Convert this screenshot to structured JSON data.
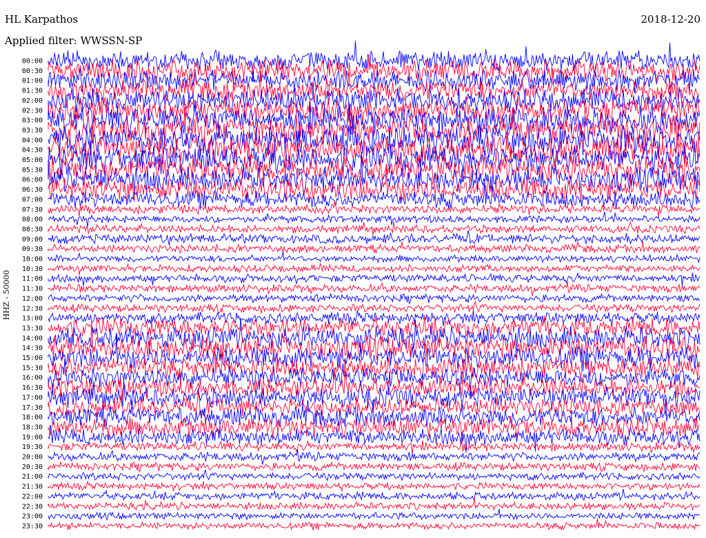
{
  "header": {
    "station": "HL Karpathos",
    "date": "2018-12-20",
    "filter": "Applied filter: WWSSN-SP"
  },
  "chart_data": {
    "type": "line",
    "title": "HL Karpathos",
    "ylabel": "HHZ - 50000",
    "colors": [
      "#0000ff",
      "#ff0033"
    ],
    "rows": [
      "00:00",
      "00:30",
      "01:00",
      "01:30",
      "02:00",
      "02:30",
      "03:00",
      "03:30",
      "04:00",
      "04:30",
      "05:00",
      "05:30",
      "06:00",
      "06:30",
      "07:00",
      "07:30",
      "08:00",
      "08:30",
      "09:00",
      "09:30",
      "10:00",
      "10:30",
      "11:00",
      "11:30",
      "12:00",
      "12:30",
      "13:00",
      "13:30",
      "14:00",
      "14:30",
      "15:00",
      "15:30",
      "16:00",
      "16:30",
      "17:00",
      "17:30",
      "18:00",
      "18:30",
      "19:00",
      "19:30",
      "20:00",
      "20:30",
      "21:00",
      "21:30",
      "22:00",
      "22:30",
      "23:00",
      "23:30"
    ],
    "noise_level": [
      0.55,
      0.6,
      0.6,
      0.65,
      0.7,
      0.75,
      0.8,
      0.85,
      0.9,
      0.9,
      0.85,
      0.8,
      0.75,
      0.7,
      0.45,
      0.15,
      0.1,
      0.12,
      0.18,
      0.12,
      0.08,
      0.1,
      0.12,
      0.12,
      0.12,
      0.12,
      0.25,
      0.55,
      0.65,
      0.7,
      0.65,
      0.6,
      0.55,
      0.55,
      0.55,
      0.5,
      0.55,
      0.55,
      0.45,
      0.15,
      0.15,
      0.12,
      0.1,
      0.08,
      0.12,
      0.1,
      0.08,
      0.08
    ]
  }
}
